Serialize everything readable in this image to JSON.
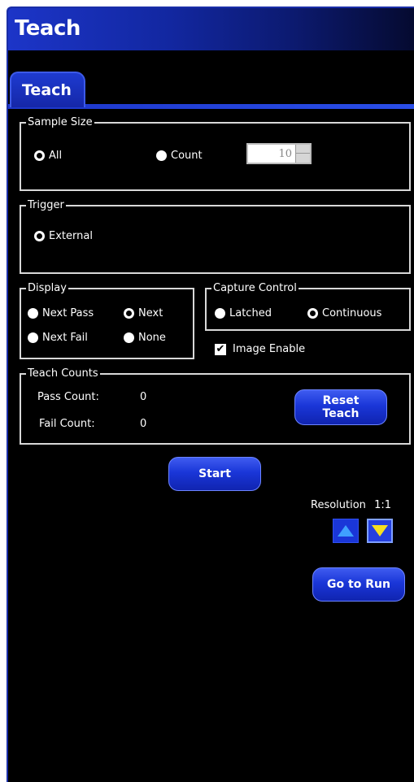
{
  "window": {
    "title": "Teach"
  },
  "tabs": [
    {
      "label": "Teach"
    }
  ],
  "sample_size": {
    "legend": "Sample Size",
    "options": [
      {
        "label": "All",
        "selected": true
      },
      {
        "label": "Count",
        "selected": false
      }
    ],
    "count_value": "10"
  },
  "trigger": {
    "legend": "Trigger",
    "options": [
      {
        "label": "External",
        "selected": true
      }
    ]
  },
  "display": {
    "legend": "Display",
    "options": [
      {
        "label": "Next Pass",
        "selected": false
      },
      {
        "label": "Next",
        "selected": true
      },
      {
        "label": "Next Fail",
        "selected": false
      },
      {
        "label": "None",
        "selected": false
      }
    ]
  },
  "capture_control": {
    "legend": "Capture Control",
    "options": [
      {
        "label": "Latched",
        "selected": false
      },
      {
        "label": "Continuous",
        "selected": true
      }
    ]
  },
  "image_enable": {
    "label": "Image Enable",
    "checked": true
  },
  "teach_counts": {
    "legend": "Teach Counts",
    "pass_label": "Pass Count:",
    "pass_value": "0",
    "fail_label": "Fail Count:",
    "fail_value": "0",
    "reset_line1": "Reset",
    "reset_line2": "Teach"
  },
  "start_label": "Start",
  "resolution": {
    "label": "Resolution",
    "value": "1:1"
  },
  "go_to_run_label": "Go to Run",
  "colors": {
    "accent": "#1a36d8",
    "background": "#000000",
    "arrow_up": "#3fa0ff",
    "arrow_down": "#f7e020"
  }
}
